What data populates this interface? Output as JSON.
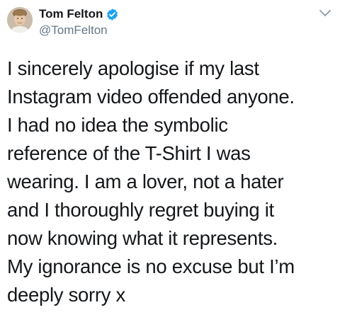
{
  "author": {
    "display_name": "Tom Felton",
    "handle": "@TomFelton",
    "verified": true
  },
  "icons": {
    "verified": "verified-badge-icon",
    "menu": "chevron-down-icon",
    "avatar": "profile-avatar"
  },
  "colors": {
    "verified_badge": "#1da1f2",
    "handle": "#657786",
    "text": "#14171a"
  },
  "tweet": {
    "lines": [
      "I sincerely apologise if my last",
      "Instagram video offended anyone.",
      "I had no idea the symbolic",
      "reference of the T-Shirt I was",
      "wearing. I am a lover, not a hater",
      "and I thoroughly regret buying it",
      "now knowing what it represents.",
      "My ignorance is no excuse but I’m",
      "deeply sorry x"
    ]
  }
}
